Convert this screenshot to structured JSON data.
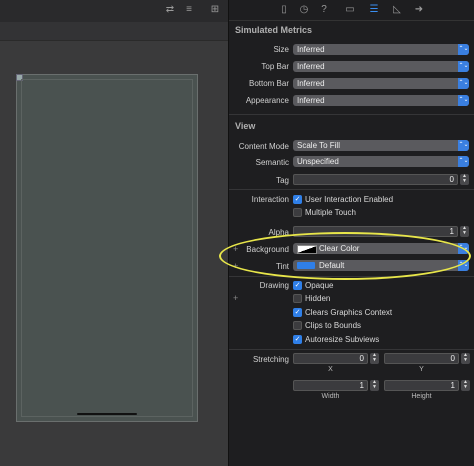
{
  "sections": {
    "simulated_metrics": "Simulated Metrics",
    "view": "View"
  },
  "metrics": [
    {
      "label": "Size",
      "value": "Inferred"
    },
    {
      "label": "Top Bar",
      "value": "Inferred"
    },
    {
      "label": "Bottom Bar",
      "value": "Inferred"
    },
    {
      "label": "Appearance",
      "value": "Inferred"
    }
  ],
  "view": {
    "content_mode": {
      "label": "Content Mode",
      "value": "Scale To Fill"
    },
    "semantic": {
      "label": "Semantic",
      "value": "Unspecified"
    },
    "tag": {
      "label": "Tag",
      "value": "0"
    },
    "interaction": {
      "label": "Interaction",
      "user_interaction": {
        "label": "User Interaction Enabled",
        "checked": true
      },
      "multiple_touch": {
        "label": "Multiple Touch",
        "checked": false
      }
    },
    "alpha": {
      "label": "Alpha",
      "value": "1"
    },
    "background": {
      "label": "Background",
      "value": "Clear Color"
    },
    "tint": {
      "label": "Tint",
      "value": "Default"
    },
    "drawing": {
      "label": "Drawing",
      "opaque": {
        "label": "Opaque",
        "checked": true
      },
      "hidden": {
        "label": "Hidden",
        "checked": false
      },
      "clears": {
        "label": "Clears Graphics Context",
        "checked": true
      },
      "clips": {
        "label": "Clips to Bounds",
        "checked": false
      },
      "autoresize": {
        "label": "Autoresize Subviews",
        "checked": true
      }
    },
    "stretching": {
      "label": "Stretching",
      "x": "0",
      "y": "0",
      "width": "1",
      "height": "1",
      "x_label": "X",
      "y_label": "Y",
      "width_label": "Width",
      "height_label": "Height"
    }
  },
  "glyphs": {
    "plus": "+",
    "check": "✓",
    "stepper_up": "▲",
    "stepper_down": "▼",
    "popup_arrows": "⌃⌄"
  },
  "colors": {
    "accent": "#2f7fe8",
    "highlight": "#e8e64a"
  }
}
